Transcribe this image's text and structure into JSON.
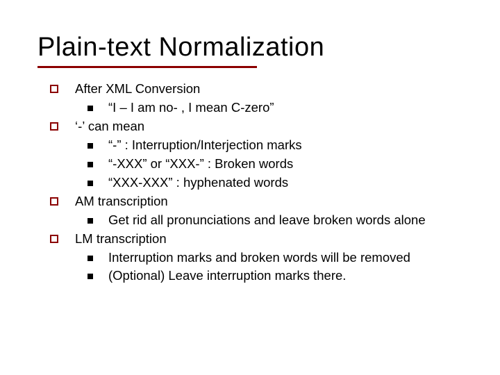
{
  "title": "Plain-text Normalization",
  "items": [
    {
      "label": "After XML Conversion",
      "sub": [
        "“I – I am no- ,  I mean C-zero”"
      ]
    },
    {
      "label": "‘-’ can mean",
      "sub": [
        "“-” : Interruption/Interjection marks",
        "“-XXX” or “XXX-” : Broken words",
        "“XXX-XXX” : hyphenated words"
      ]
    },
    {
      "label": "AM transcription",
      "sub": [
        "Get rid all pronunciations and leave broken words alone"
      ]
    },
    {
      "label": "LM transcription",
      "sub": [
        "Interruption marks and broken words will be removed",
        "(Optional) Leave interruption marks there."
      ]
    }
  ]
}
